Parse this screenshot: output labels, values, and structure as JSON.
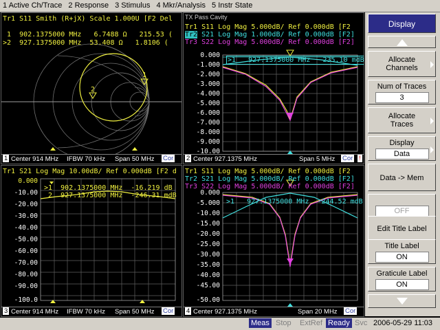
{
  "menu": [
    "1 Active Ch/Trace",
    "2 Response",
    "3 Stimulus",
    "4 Mkr/Analysis",
    "5 Instr State"
  ],
  "win1": {
    "trace_line": "Tr1 S11 Smith (R+jX) Scale 1.000U [F2 Del",
    "marker1": " 1  902.1375000 MHz   6.7488 Ω   215.53 (",
    "marker2": ">2  927.1375000 MHz  53.408 Ω   1.8106 (",
    "footer": {
      "num": "1",
      "center": "Center 914 MHz",
      "ifbw": "IFBW 70 kHz",
      "span": "Span 50 MHz",
      "cor": "Cor"
    }
  },
  "win2": {
    "title": "TX Pass Cavity",
    "tr1": "Tr1 S11 Log Mag 5.000dB/ Ref 0.000dB [F2",
    "tr2a": "Tr2",
    "tr2b": " S21 Log Mag 1.000dB/ Ref 0.000dB [F2]",
    "tr3": "Tr3 S22 Log Mag 5.000dB/ Ref 0.000dB [F2]",
    "marker": ">1   927.1375000 MHz  -235.10 mdB",
    "yticks": [
      "0.000",
      "-1.000",
      "-2.000",
      "-3.000",
      "-4.000",
      "-5.000",
      "-6.000",
      "-7.000",
      "-8.000",
      "-9.000",
      "-10.00"
    ],
    "footer": {
      "num": "2",
      "center": "Center 927.1375 MHz",
      "span": "Span 5 MHz",
      "cor": "Cor",
      "excl": "!"
    }
  },
  "win3": {
    "tr1": "Tr1 S21 Log Mag 10.00dB/ Ref 0.000dB [F2 d",
    "marker1": ">1  902.1375000 MHz  -16.219 dB",
    "marker2": " 2  927.1375000 MHz  -246.31 mdB",
    "yticks": [
      "0.000",
      "-10.00",
      "-20.00",
      "-30.00",
      "-40.00",
      "-50.00",
      "-60.00",
      "-70.00",
      "-80.00",
      "-90.00",
      "-100.0"
    ],
    "footer": {
      "num": "3",
      "center": "Center 914 MHz",
      "ifbw": "IFBW 70 kHz",
      "span": "Span 50 MHz",
      "cor": "Cor"
    }
  },
  "win4": {
    "tr1": "Tr1 S11 Log Mag 5.000dB/ Ref 0.000dB [F2",
    "tr2": "Tr2 S21 Log Mag 5.000dB/ Ref 0.000dB [F2]",
    "tr3": "Tr3 S22 Log Mag 5.000dB/ Ref 0.000dB [F2]",
    "marker": ">1   927.1375000 MHz  -244.52 mdB",
    "yticks": [
      "0.000",
      "-5.000",
      "-10.00",
      "-15.00",
      "-20.00",
      "-25.00",
      "-30.00",
      "-35.00",
      "-40.00",
      "-45.00",
      "-50.00"
    ],
    "footer": {
      "num": "4",
      "center": "Center 927.1375 MHz",
      "span": "Span 20 MHz",
      "cor": "Cor"
    }
  },
  "softkeys": {
    "title": "Display",
    "allocate_channels": "Allocate Channels",
    "num_traces_label": "Num of Traces",
    "num_traces_value": "3",
    "allocate_traces": "Allocate Traces",
    "display_label": "Display",
    "display_value": "Data",
    "data_mem": "Data -> Mem",
    "off_value": "OFF",
    "edit_title": "Edit Title Label",
    "title_label": "Title Label",
    "title_label_value": "ON",
    "graticule_label": "Graticule Label",
    "graticule_value": "ON"
  },
  "status": {
    "meas": "Meas",
    "stop": "Stop",
    "extref": "ExtRef",
    "ready": "Ready",
    "svc": "Svc",
    "datetime": "2006-05-29 11:03"
  },
  "colors": {
    "tr1": "#f0f040",
    "tr2": "#40e0e0",
    "tr3": "#e040e0",
    "grid": "#808080",
    "bg": "#000000"
  }
}
